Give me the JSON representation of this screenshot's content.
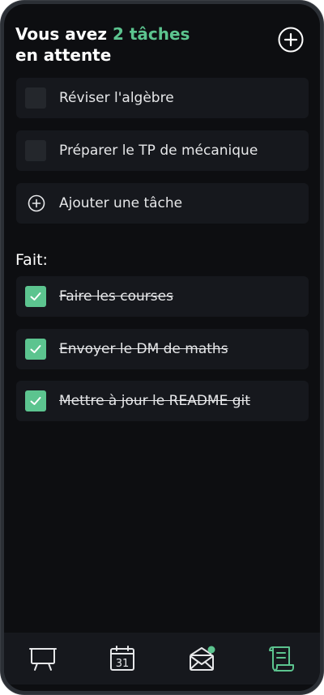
{
  "header": {
    "title_prefix": "Vous avez ",
    "title_accent": "2 tâches",
    "title_suffix": "en attente"
  },
  "pending": [
    {
      "label": "Réviser l'algèbre",
      "done": false
    },
    {
      "label": "Préparer le TP de mécanique",
      "done": false
    }
  ],
  "add_task_label": "Ajouter une tâche",
  "done_section": {
    "title": "Fait:",
    "items": [
      {
        "label": "Faire les courses",
        "done": true
      },
      {
        "label": "Envoyer le DM de maths",
        "done": true
      },
      {
        "label": "Mettre à jour le README git",
        "done": true
      }
    ]
  },
  "nav": {
    "calendar_day": "31",
    "items": [
      "presentation-board-icon",
      "calendar-icon",
      "mail-icon",
      "receipt-icon"
    ],
    "active": "receipt-icon"
  },
  "colors": {
    "accent": "#5cc48f",
    "background": "#0d0e11",
    "card": "#16181d"
  }
}
